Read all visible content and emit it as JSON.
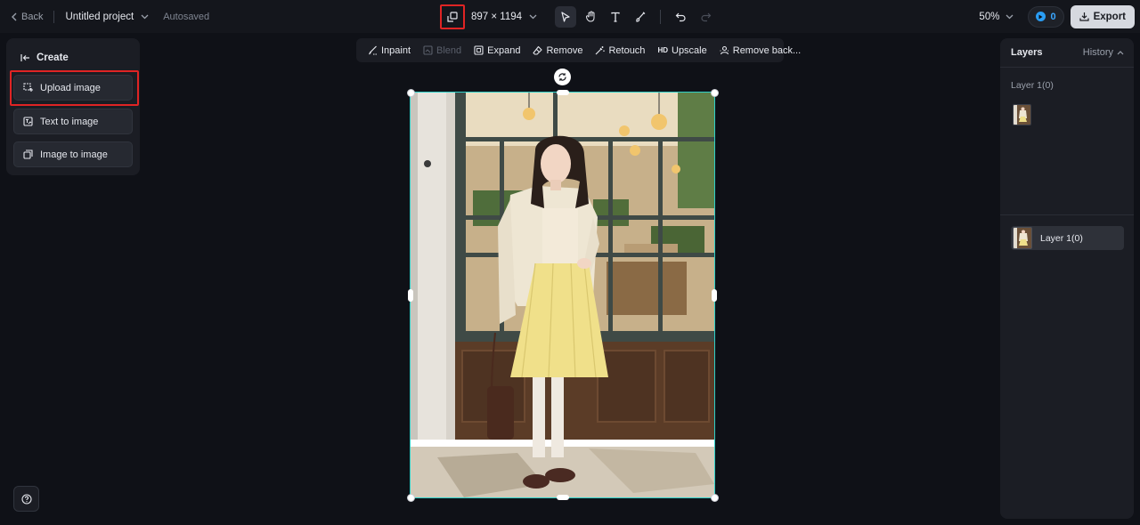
{
  "topbar": {
    "back_label": "Back",
    "project_name": "Untitled project",
    "autosave_status": "Autosaved",
    "canvas_size": "897 × 1194",
    "zoom_level": "50%",
    "credits": "0",
    "export_label": "Export"
  },
  "left_panel": {
    "title": "Create",
    "items": [
      {
        "label": "Upload image",
        "icon": "upload-image-icon"
      },
      {
        "label": "Text to image",
        "icon": "text-to-image-icon"
      },
      {
        "label": "Image to image",
        "icon": "image-to-image-icon"
      }
    ]
  },
  "edit_toolbar": {
    "items": [
      {
        "label": "Inpaint",
        "icon": "inpaint-icon",
        "enabled": true
      },
      {
        "label": "Blend",
        "icon": "blend-icon",
        "enabled": false
      },
      {
        "label": "Expand",
        "icon": "expand-icon",
        "enabled": true
      },
      {
        "label": "Remove",
        "icon": "eraser-icon",
        "enabled": true
      },
      {
        "label": "Retouch",
        "icon": "magic-wand-icon",
        "enabled": true
      },
      {
        "label": "Upscale",
        "icon": "hd-icon",
        "badge": "HD",
        "enabled": true
      },
      {
        "label": "Remove back...",
        "icon": "remove-background-icon",
        "enabled": true
      }
    ]
  },
  "right_panel": {
    "tab_layers": "Layers",
    "tab_history": "History",
    "layer_group_label": "Layer 1(0)",
    "selected_layer_label": "Layer 1(0)"
  },
  "colors": {
    "background": "#0f1117",
    "panel": "#1b1d24",
    "selection": "#2fd0c8",
    "highlight": "#e02424",
    "credits": "#3aa7ff"
  }
}
